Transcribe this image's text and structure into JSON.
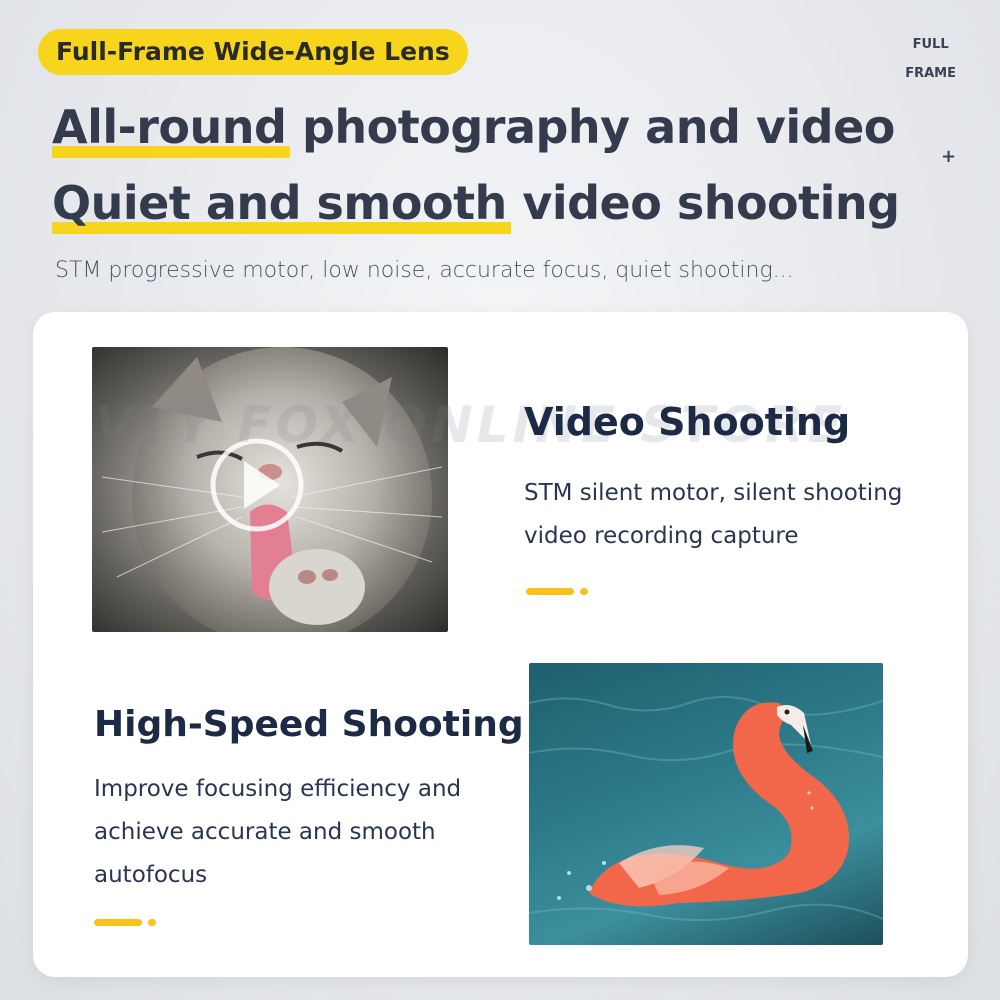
{
  "header": {
    "badge": "Full-Frame Wide-Angle Lens",
    "corner_line1": "FULL",
    "corner_line2": "FRAME",
    "plus": "+",
    "headline1_mark": "All-round",
    "headline1_rest": " photography and video",
    "headline2_mark": "Quiet and smooth",
    "headline2_rest": " video shooting",
    "subtitle": "STM progressive motor, low noise, accurate focus, quiet shooting..."
  },
  "watermark": "VTY FOX ONLINE STORE",
  "features": [
    {
      "title": "Video Shooting",
      "desc_line1": "STM silent motor, silent shooting",
      "desc_line2": "video recording capture"
    },
    {
      "title": "High-Speed Shooting",
      "desc_line1": "Improve focusing efficiency and",
      "desc_line2": "achieve accurate and smooth",
      "desc_line3": "autofocus"
    }
  ],
  "colors": {
    "accent_yellow": "#f7d51d",
    "heading_dark": "#1d2a45",
    "flamingo_pink": "#f2674a",
    "water_teal": "#2c7988"
  }
}
